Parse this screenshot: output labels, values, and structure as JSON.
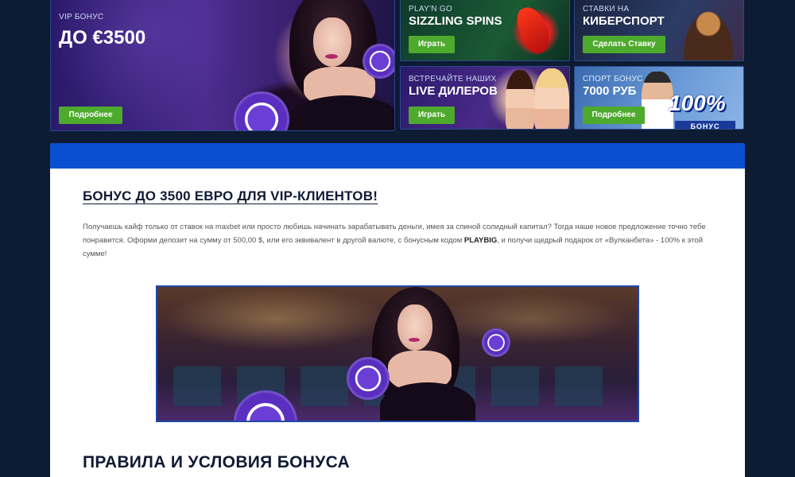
{
  "banners": {
    "vip": {
      "label": "VIP БОНУС",
      "title": "ДО €3500",
      "button": "Подробнее"
    },
    "sizzling": {
      "label": "PLAY'N GO",
      "title": "SIZZLING SPINS",
      "button": "Играть"
    },
    "esport": {
      "label": "СТАВКИ НА",
      "title": "КИБЕРСПОРТ",
      "button": "Сделать Ставку"
    },
    "live": {
      "label": "ВСТРЕЧАЙТЕ НАШИХ",
      "title": "LIVE ДИЛЕРОВ",
      "button": "Играть"
    },
    "sport": {
      "label": "СПОРТ БОНУС",
      "title": "7000 РУБ",
      "button": "Подробнее",
      "percent": "100%",
      "tag": "БОНУС"
    }
  },
  "content": {
    "heading": "БОНУС ДО 3500 ЕВРО ДЛЯ VIP-КЛИЕНТОВ!",
    "text_1": "Получаешь кайф только от ставок на maxbet или просто любишь начинать зарабатывать деньги, имея за спиной солидный капитал? Тогда наше новое предложение точно тебе понравится. Оформи депозит на сумму от 500,00 $, или его эквивалент в другой валюте, с бонусным кодом ",
    "promo_code": "PLAYBIG",
    "text_2": ", и получи щедрый подарок от «Вулканбета» - 100% к этой сумме!",
    "rules_heading": "ПРАВИЛА И УСЛОВИЯ БОНУСА"
  },
  "colors": {
    "page_bg": "#0d1b33",
    "panel_header": "#0a4fcf",
    "button_green": "#4eaa2d"
  }
}
